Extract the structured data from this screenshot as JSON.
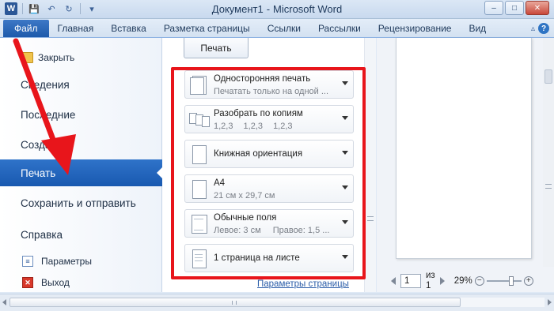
{
  "window": {
    "title_doc": "Документ1",
    "title_sep": "-",
    "title_app": "Microsoft Word",
    "buttons": {
      "minimize": "–",
      "maximize": "□",
      "close": "✕"
    }
  },
  "qat": {
    "word_letter": "W",
    "save": "💾",
    "undo": "↶",
    "redo": "↻",
    "customize": "▾"
  },
  "ribbon": {
    "file_tab": "Файл",
    "tabs": [
      "Главная",
      "Вставка",
      "Разметка страницы",
      "Ссылки",
      "Рассылки",
      "Рецензирование",
      "Вид"
    ],
    "help_icons": {
      "collapse": "▵",
      "help": "?"
    }
  },
  "nav": {
    "close": "Закрыть",
    "details": "Сведения",
    "recent": "Последние",
    "create": "Создать",
    "print": "Печать",
    "save_send": "Сохранить и отправить",
    "help": "Справка",
    "options": "Параметры",
    "exit": "Выход"
  },
  "print_settings": {
    "print_button": "Печать",
    "sides": {
      "title": "Односторонняя печать",
      "subtitle": "Печатать только на одной ..."
    },
    "collate": {
      "title": "Разобрать по копиям",
      "pattern": [
        "1,2,3",
        "1,2,3",
        "1,2,3"
      ]
    },
    "orientation": {
      "title": "Книжная ориентация"
    },
    "paper": {
      "title": "A4",
      "subtitle": "21 см x 29,7 см"
    },
    "margins": {
      "title": "Обычные поля",
      "subtitle_left": "Левое:  3 см",
      "subtitle_right": "Правое:  1,5 ..."
    },
    "pages_per_sheet": {
      "title": "1 страница на листе"
    },
    "page_setup_link": "Параметры страницы"
  },
  "preview": {
    "page_current": "1",
    "page_of": "из",
    "page_total": "1",
    "zoom_level": "29%",
    "zoom_minus": "−",
    "zoom_plus": "+"
  },
  "colors": {
    "accent": "#2f73c9",
    "highlight": "#e8151b"
  }
}
